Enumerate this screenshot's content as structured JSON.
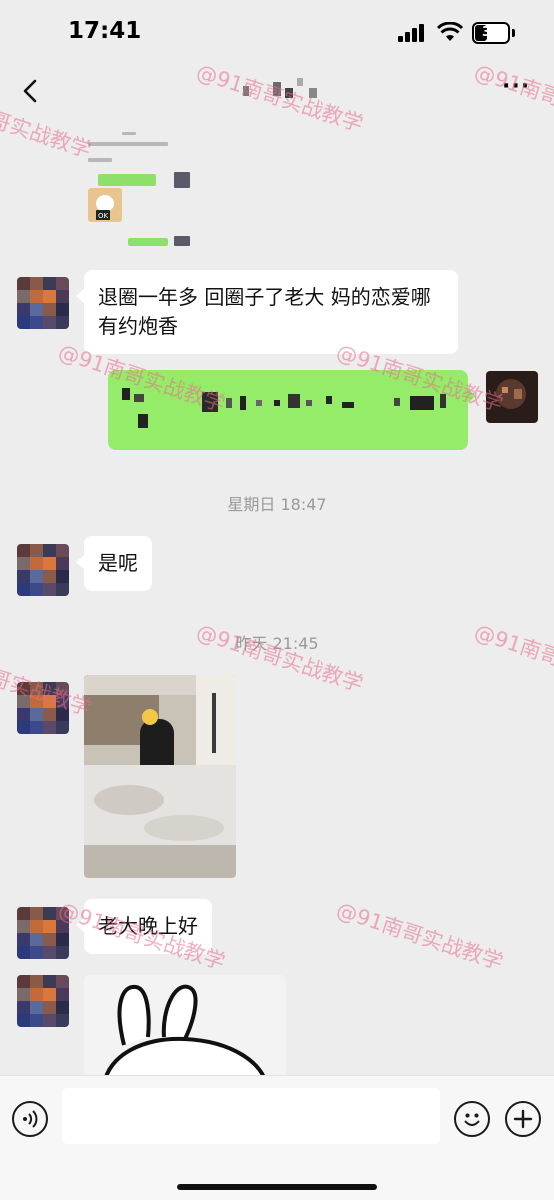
{
  "status_bar": {
    "time": "17:41",
    "battery_level": "34",
    "battery_fraction": 0.34,
    "icons": [
      "signal-icon",
      "wifi-icon",
      "battery-icon"
    ]
  },
  "nav": {
    "back_icon": "chevron-left-icon",
    "more_label": "···"
  },
  "messages": [
    {
      "side": "left",
      "type": "text",
      "text": "退圈一年多 回圈子了老大 妈的恋爱哪有约炮香"
    },
    {
      "side": "right",
      "type": "pixelated-text"
    },
    {
      "type": "timestamp",
      "text": "星期日 18:47"
    },
    {
      "side": "left",
      "type": "text",
      "text": "是呢"
    },
    {
      "type": "timestamp",
      "text": "昨天 21:45"
    },
    {
      "side": "left",
      "type": "photo",
      "icon": "photo-bedroom"
    },
    {
      "side": "left",
      "type": "text",
      "text": "老大晚上好"
    },
    {
      "side": "left",
      "type": "sticker",
      "icon": "rabbit-sticker"
    }
  ],
  "quoted_screenshot": {
    "dog_label": "OK"
  },
  "watermark": "@91南哥实战教学",
  "input_bar": {
    "voice_icon": "voice-icon",
    "emoji_icon": "emoji-icon",
    "plus_icon": "plus-icon"
  }
}
